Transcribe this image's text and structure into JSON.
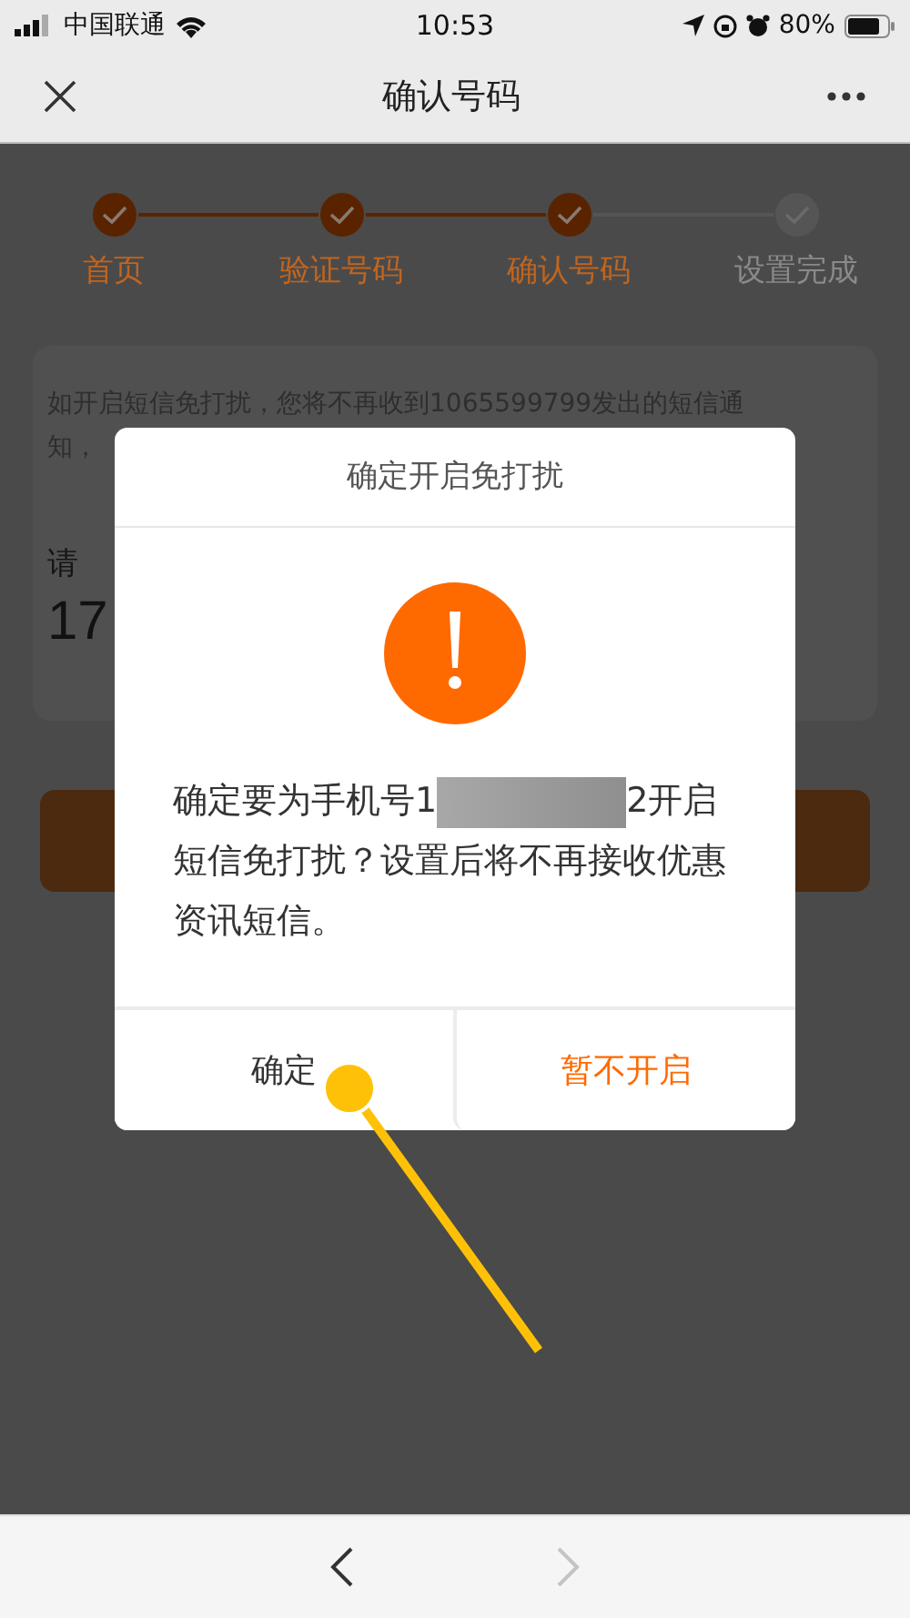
{
  "status_bar": {
    "carrier": "中国联通",
    "time": "10:53",
    "battery": "80%"
  },
  "nav_bar": {
    "title": "确认号码"
  },
  "steps": [
    {
      "label": "首页",
      "done": true
    },
    {
      "label": "验证号码",
      "done": true
    },
    {
      "label": "确认号码",
      "done": true
    },
    {
      "label": "设置完成",
      "done": false
    }
  ],
  "card": {
    "notice_line_1": "如开启短信免打扰，您将不再收到1065599799发出的短信通",
    "notice_line_2": "知，",
    "phone_label": "请",
    "phone_value": "17"
  },
  "dialog": {
    "title": "确定开启免打扰",
    "message_before": "确定要为手机号1",
    "message_after": "2开启",
    "message_rest": "短信免打扰？设置后将不再接收优惠资讯短信。",
    "buttons": [
      {
        "label": "确定",
        "kind": "confirm"
      },
      {
        "label": "暂不开启",
        "kind": "cancel"
      }
    ]
  },
  "browser_bar": {
    "back_disabled": false,
    "forward_disabled": true
  }
}
